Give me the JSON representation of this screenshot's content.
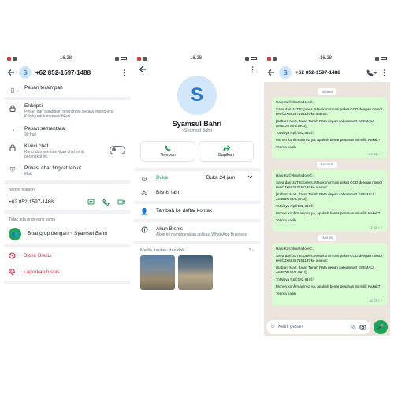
{
  "status": {
    "time": "16.28"
  },
  "panel1": {
    "header": {
      "avatar_letter": "S",
      "title": "+62 852-1597-1488"
    },
    "saved_messages": "Pesan tersimpan",
    "encryption": {
      "title": "Enkripsi",
      "desc": "Pesan dan panggilan terenkripsi secara end-to-end. Ketuk untuk memverifikasi."
    },
    "temporary": {
      "title": "Pesan sementara",
      "desc": "90 hari"
    },
    "chat_lock": {
      "title": "Kunci chat",
      "desc": "Kunci dan sembunyikan chat ini di perangkat ini.",
      "enabled": false
    },
    "advanced_privacy": {
      "title": "Privasi chat tingkat lanjut",
      "desc": "Mati"
    },
    "phone_label": "Nomor telepon",
    "phone_number": "+62 852-1597-1488",
    "no_group_label": "Tidak ada grup yang sama",
    "create_group": "Buat grup dengan ~ Syamsul Bahri",
    "block": "Blokir Bisnis",
    "report": "Laporkan bisnis",
    "colors": {
      "green": "#1a9c59",
      "danger": "#d1334b"
    }
  },
  "panel2": {
    "avatar_letter": "S",
    "name": "Syamsul Bahri",
    "subtitle": "~Syamsul Bahri",
    "call_label": "Telepon",
    "share_label": "Bagikan",
    "hours": {
      "status": "Buka",
      "value": "Buka 24 jam"
    },
    "more_info": "Bisnis lain",
    "add_contact": "Tambah ke daftar kontak",
    "business_account": {
      "title": "Akun Bisnis",
      "desc": "Akun ini menggunakan aplikasi WhatsApp Business"
    },
    "media": {
      "label": "Media, tautan, dan dok",
      "count": "2"
    }
  },
  "panel3": {
    "header": {
      "avatar_letter": "S",
      "title": "+62 852-1597-1488"
    },
    "messages": [
      {
        "date": "Selasa",
        "lines": [
          "Halo Ka©elmaradore©,",
          "Saya dari J&T Express, Mau konfirmasi paket COD dengan nomor resi©JX6836715113©ke alamat:",
          "[Saburo Mart, Jalan Tanah Rata depan saburomart SIRIMAU AMBON MALUKU]",
          "Totalnya Rp©182,810©",
          "Mohon konfirmasinya ya, apakah benar pesanan ini milik Kakak?",
          "Terima kasih"
        ],
        "time": "07.49"
      },
      {
        "date": "Kemarin",
        "lines": [
          "Halo Ka©elmaradore©,",
          "Saya dari J&T Express, Mau konfirmasi paket COD dengan nomor resi©JX6836715113©ke alamat:",
          "[Saburo Mart, Jalan Tanah Rata depan saburomart SIRIMAU AMBON MALUKU]",
          "Totalnya Rp©182,810©",
          "Mohon konfirmasinya ya, apakah benar pesanan ini milik Kakak?",
          "Terima kasih"
        ],
        "time": "17.52"
      },
      {
        "date": "Hari ini",
        "lines": [
          "Halo Ka©elmaradore©,",
          "Saya dari J&T Express, Mau konfirmasi paket COD dengan nomor resi©JX6836715113©ke alamat:",
          "[Saburo Mart, Jalan Tanah Rata depan saburomart SIRIMAU AMBON MALUKU]",
          "Totalnya Rp©182,810©",
          "Mohon konfirmasinya ya, apakah benar pesanan ini milik Kakak?",
          "Terima kasih"
        ],
        "time": "16.27"
      }
    ],
    "input_placeholder": "Ketik pesan"
  }
}
